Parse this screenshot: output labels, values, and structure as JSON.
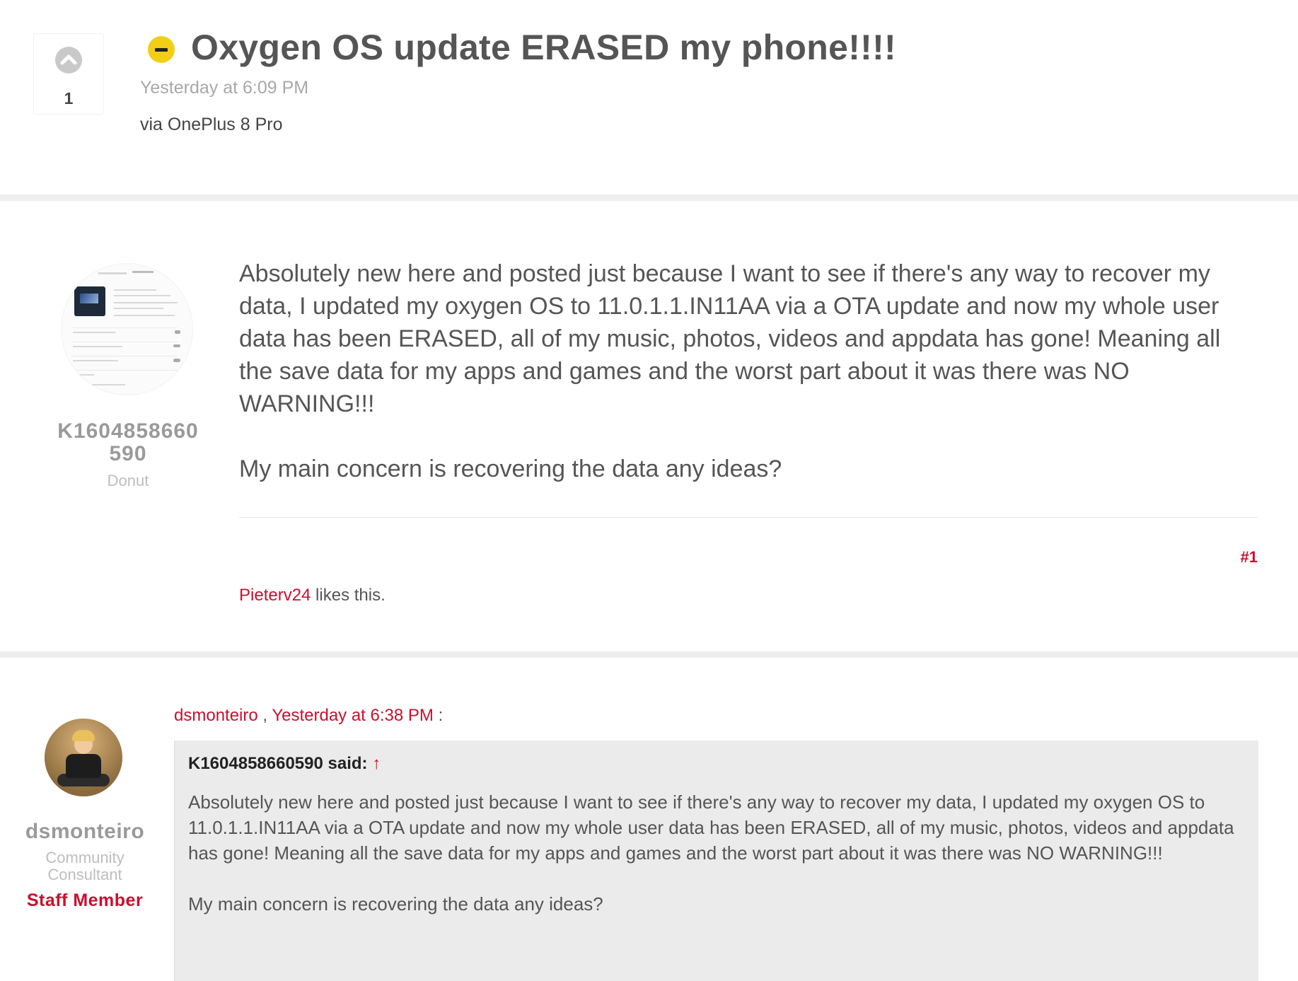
{
  "thread": {
    "vote_count": "1",
    "title": "Oxygen OS update ERASED my phone!!!!",
    "date": "Yesterday at 6:09 PM",
    "device": "via OnePlus 8 Pro"
  },
  "post1": {
    "author": {
      "name_line1": "K1604858660",
      "name_line2": "590",
      "title": "Donut"
    },
    "paragraph1": "Absolutely new here and posted just because I want to see if there's any way to recover my data, I updated my oxygen OS to 11.0.1.1.IN11AA via a OTA update and now my whole user data has been ERASED, all of my music, photos, videos and appdata has gone! Meaning all the save data for my apps and games and the worst part about it was there was NO WARNING!!!",
    "paragraph2": "My main concern is recovering the data any ideas?",
    "post_number": "#1",
    "liker": "Pieterv24",
    "likes_suffix": " likes this."
  },
  "post2": {
    "author": {
      "name": "dsmonteiro",
      "title_line1": "Community",
      "title_line2": "Consultant",
      "badge": "Staff Member"
    },
    "attribution": {
      "user": "dsmonteiro",
      "separator": " , ",
      "date": "Yesterday at 6:38 PM",
      "suffix": " :"
    },
    "quote": {
      "header": "K1604858660590 said: ",
      "arrow": "↑",
      "paragraph1": "Absolutely new here and posted just because I want to see if there's any way to recover my data, I updated my oxygen OS to 11.0.1.1.IN11AA via a OTA update and now my whole user data has been ERASED, all of my music, photos, videos and appdata has gone! Meaning all the save data for my apps and games and the worst part about it was there was NO WARNING!!!",
      "paragraph2": "My main concern is recovering the data any ideas?"
    }
  },
  "colors": {
    "accent": "#c8102e",
    "status_yellow": "#f2cf14",
    "separator": "#eeeeee",
    "quote_background": "#ebebeb"
  },
  "icons": {
    "vote": "upvote-chevron-icon",
    "status": "minus-circle-icon"
  }
}
